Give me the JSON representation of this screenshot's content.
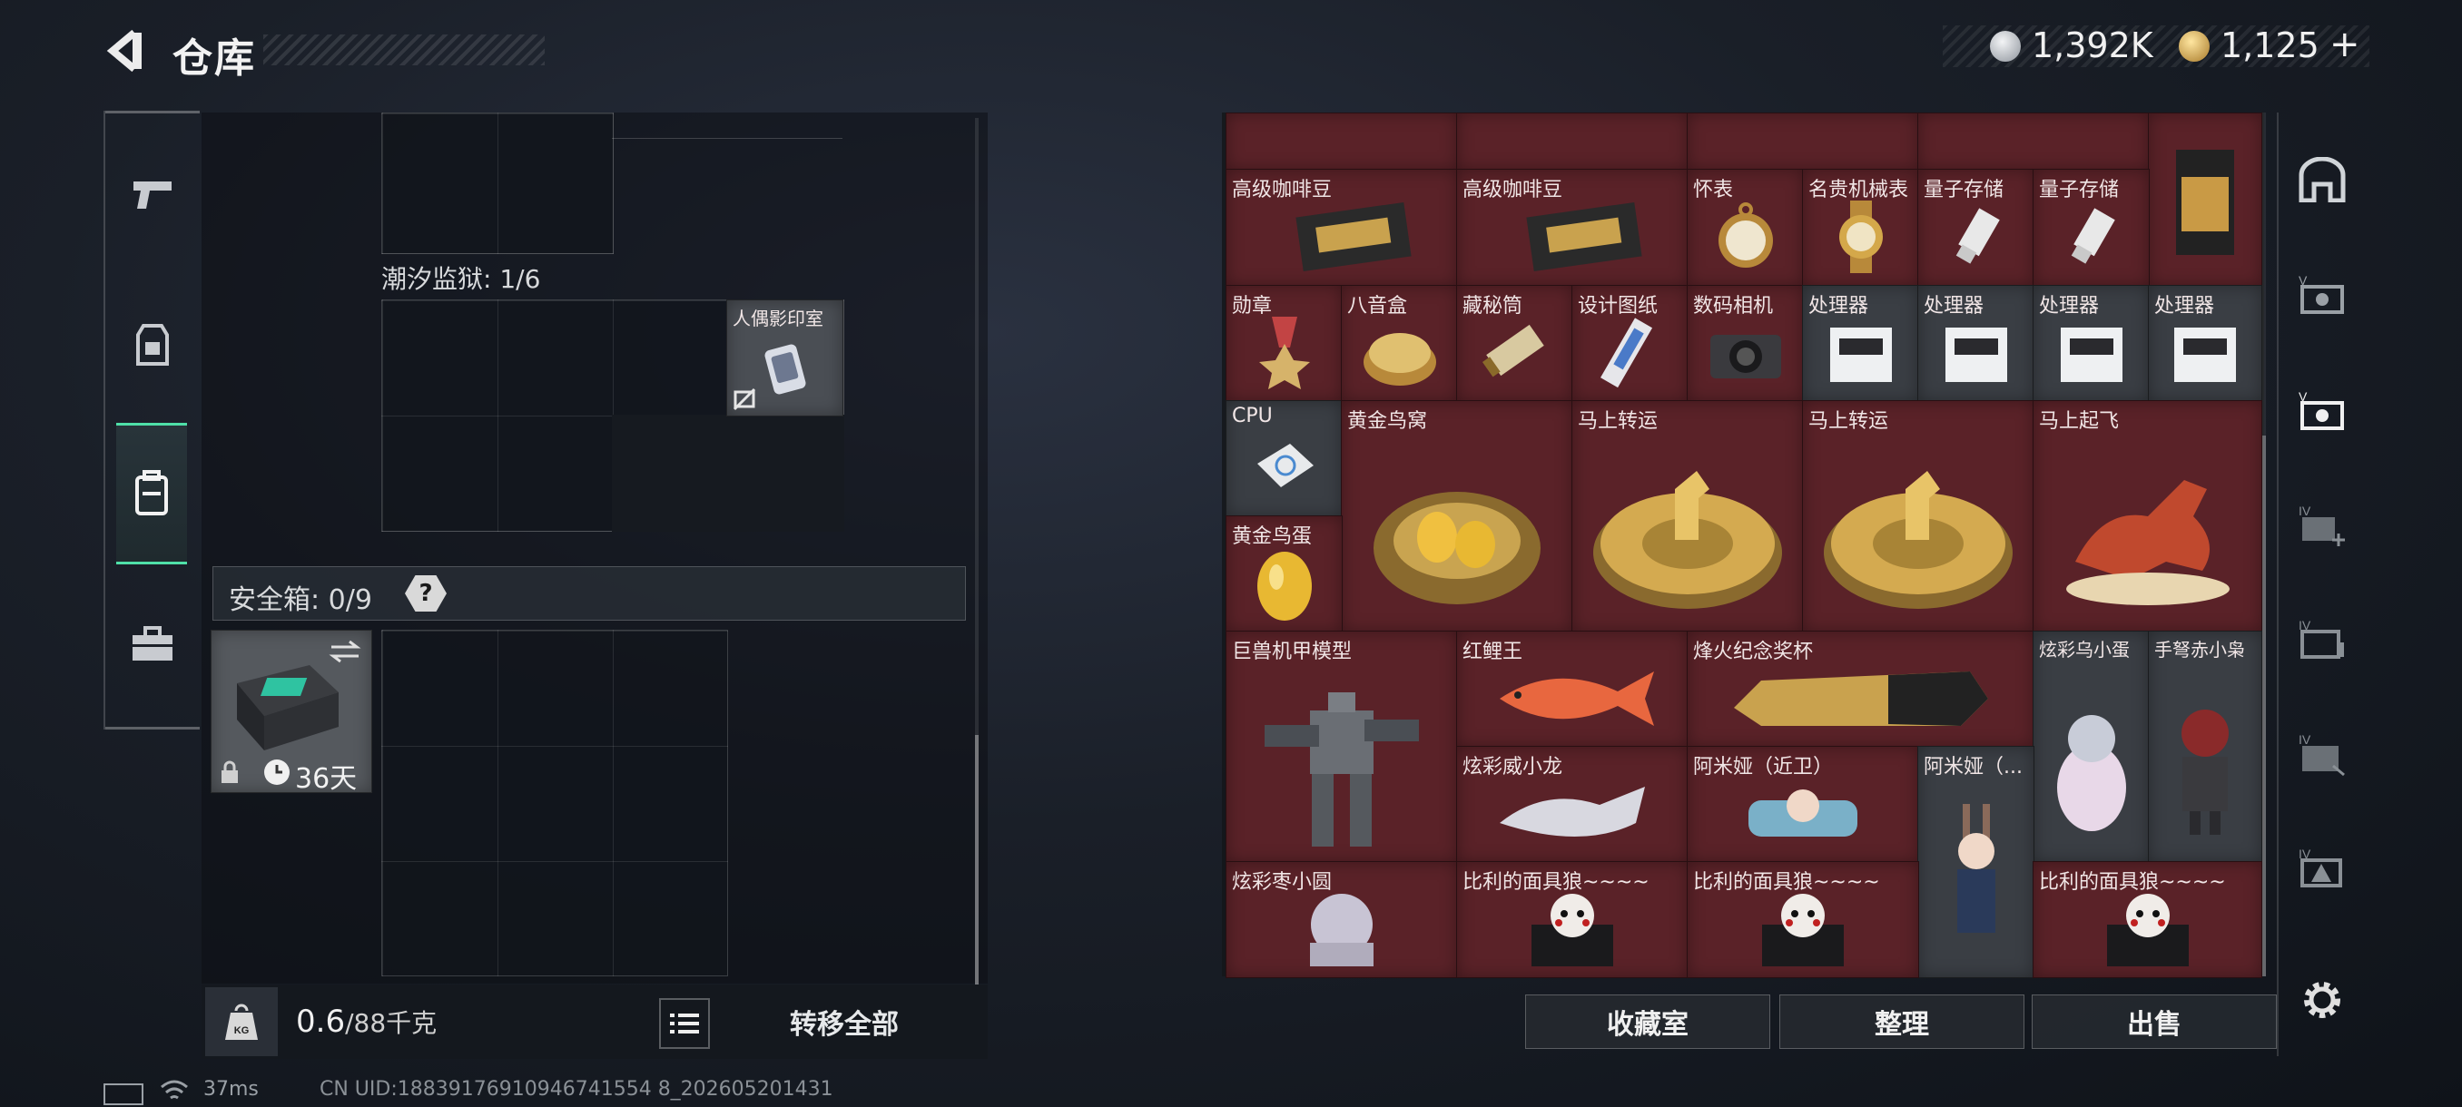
{
  "header": {
    "title": "仓库",
    "back_icon": "arrow-left-icon"
  },
  "currency": [
    {
      "icon": "silver-coin-icon",
      "value": "1,392K",
      "color": "#c9ccd2"
    },
    {
      "icon": "gold-coin-icon",
      "value": "1,125",
      "plus": "+",
      "color": "#d9b15a"
    }
  ],
  "left_nav": [
    {
      "icon": "pistol-icon",
      "active": false
    },
    {
      "icon": "backpack-vest-icon",
      "active": false
    },
    {
      "icon": "backpack-icon",
      "active": true
    },
    {
      "icon": "briefcase-icon",
      "active": false
    }
  ],
  "storage": {
    "section_label": "潮汐监狱: 1/6",
    "item_label": "人偶影印室",
    "safebox_label": "安全箱: 0/9",
    "safebox_help": "?",
    "safebox_timer": "36天"
  },
  "weight": {
    "current": "0.6",
    "max": "/88千克"
  },
  "transfer_all": "转移全部",
  "items": [
    {
      "label": "高级咖啡豆"
    },
    {
      "label": "高级咖啡豆"
    },
    {
      "label": "怀表"
    },
    {
      "label": "名贵机械表"
    },
    {
      "label": "量子存储"
    },
    {
      "label": "量子存储"
    },
    {
      "label": "勋章"
    },
    {
      "label": "八音盒"
    },
    {
      "label": "藏秘筒"
    },
    {
      "label": "设计图纸"
    },
    {
      "label": "数码相机"
    },
    {
      "label": "处理器"
    },
    {
      "label": "处理器"
    },
    {
      "label": "处理器"
    },
    {
      "label": "处理器"
    },
    {
      "label": "CPU"
    },
    {
      "label": "黄金鸟窝"
    },
    {
      "label": "马上转运"
    },
    {
      "label": "马上转运"
    },
    {
      "label": "马上起飞"
    },
    {
      "label": "黄金鸟蛋"
    },
    {
      "label": "巨兽机甲模型"
    },
    {
      "label": "红鲤王"
    },
    {
      "label": "烽火纪念奖杯"
    },
    {
      "label": "炫彩乌小蛋"
    },
    {
      "label": "手弩赤小枭"
    },
    {
      "label": "炫彩威小龙"
    },
    {
      "label": "阿米娅（近卫）"
    },
    {
      "label": "阿米娅（..."
    },
    {
      "label": "炫彩枣小圆"
    },
    {
      "label": "比利的面具狼~~~~"
    },
    {
      "label": "比利的面具狼~~~~"
    },
    {
      "label": "比利的面具狼~~~~"
    }
  ],
  "right_nav": [
    {
      "icon": "home-arch-icon"
    },
    {
      "icon": "tier-v-storage-icon"
    },
    {
      "icon": "tier-v-storage-active-icon"
    },
    {
      "icon": "tier-iv-add-icon"
    },
    {
      "icon": "tier-iv-case-icon"
    },
    {
      "icon": "tier-iv-transfer-icon"
    },
    {
      "icon": "tier-iv-warning-icon"
    },
    {
      "icon": "gear-icon"
    }
  ],
  "buttons": {
    "collection": "收藏室",
    "organize": "整理",
    "sell": "出售"
  },
  "footer": {
    "ping": "37ms",
    "uid": "CN UID:18839176910946741554 8_202605201431"
  },
  "colors": {
    "accent": "#4fe0a8",
    "item_bg": "#5a2228"
  }
}
